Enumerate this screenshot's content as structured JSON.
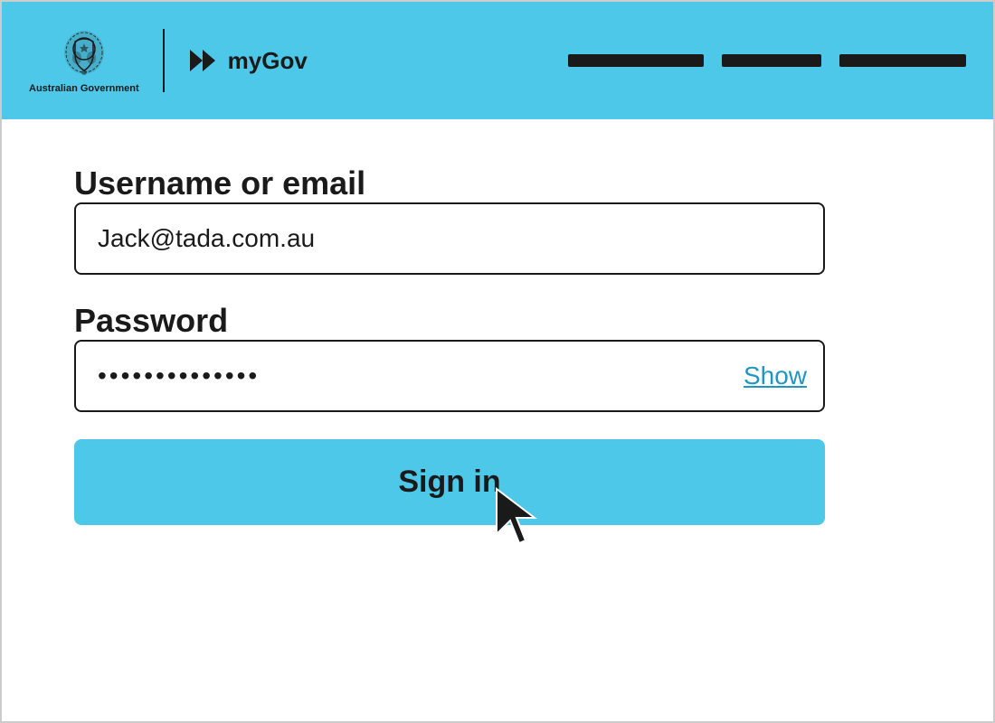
{
  "header": {
    "gov_text": "Australian Government",
    "mygov_label": "myGov",
    "nav_items": [
      "",
      "",
      ""
    ]
  },
  "form": {
    "username_label": "Username or email",
    "username_value": "Jack@tada.com.au",
    "username_placeholder": "Username or email",
    "password_label": "Password",
    "password_value": "••••••••••••••••",
    "show_label": "Show",
    "signin_label": "Sign in"
  },
  "colors": {
    "header_bg": "#4ec8e8",
    "button_bg": "#4ec8e8",
    "text_dark": "#1a1a1a",
    "link_blue": "#2196c4"
  }
}
